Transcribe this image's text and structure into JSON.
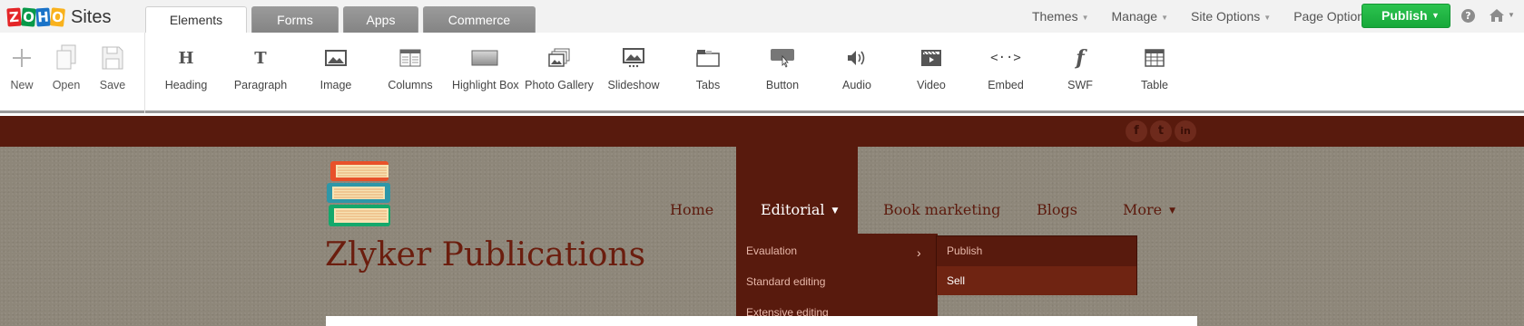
{
  "app": {
    "logo_letters": [
      "Z",
      "O",
      "H",
      "O"
    ],
    "logo_colors": [
      "#e42527",
      "#089949",
      "#1a73c8",
      "#f9b21d"
    ],
    "name": "Sites"
  },
  "editor_tabs": [
    {
      "label": "Elements",
      "active": true
    },
    {
      "label": "Forms",
      "active": false
    },
    {
      "label": "Apps",
      "active": false
    },
    {
      "label": "Commerce",
      "active": false
    }
  ],
  "top_menu": {
    "themes": "Themes",
    "manage": "Manage",
    "site_options": "Site Options",
    "page_options": "Page Options",
    "publish": "Publish",
    "help_icon": "?"
  },
  "file_tools": [
    {
      "label": "New",
      "icon": "plus-icon"
    },
    {
      "label": "Open",
      "icon": "open-pages-icon"
    },
    {
      "label": "Save",
      "icon": "floppy-disk-icon"
    }
  ],
  "element_tools": [
    {
      "label": "Heading",
      "icon": "heading-icon",
      "glyph": "H"
    },
    {
      "label": "Paragraph",
      "icon": "paragraph-icon",
      "glyph": "T"
    },
    {
      "label": "Image",
      "icon": "image-icon"
    },
    {
      "label": "Columns",
      "icon": "columns-icon"
    },
    {
      "label": "Highlight Box",
      "icon": "highlight-box-icon"
    },
    {
      "label": "Photo Gallery",
      "icon": "photo-gallery-icon"
    },
    {
      "label": "Slideshow",
      "icon": "slideshow-icon"
    },
    {
      "label": "Tabs",
      "icon": "tabs-icon"
    },
    {
      "label": "Button",
      "icon": "button-icon"
    },
    {
      "label": "Audio",
      "icon": "audio-icon"
    },
    {
      "label": "Video",
      "icon": "video-icon"
    },
    {
      "label": "Embed",
      "icon": "embed-icon",
      "glyph": "<··>"
    },
    {
      "label": "SWF",
      "icon": "swf-icon",
      "glyph": "f"
    },
    {
      "label": "Table",
      "icon": "table-icon"
    }
  ],
  "site": {
    "colors": {
      "band": "#581a0d",
      "brand_text": "#6b1d0e",
      "background": "#8e877a"
    },
    "social": [
      {
        "icon": "facebook-icon",
        "glyph": "f"
      },
      {
        "icon": "twitter-icon",
        "glyph": "t"
      },
      {
        "icon": "linkedin-icon",
        "glyph": "in"
      }
    ],
    "brand_name": "Zlyker Publications",
    "nav": [
      {
        "label": "Home",
        "active": false
      },
      {
        "label": "Editorial",
        "active": true
      },
      {
        "label": "Book marketing",
        "active": false
      },
      {
        "label": "Blogs",
        "active": false
      },
      {
        "label": "More",
        "active": false
      }
    ],
    "dropdown": [
      "Evaulation",
      "Standard editing",
      "Extensive editing"
    ],
    "submenu": [
      "Publish",
      "Sell"
    ],
    "nav_caret": "▼",
    "submenu_arrow": "›"
  }
}
